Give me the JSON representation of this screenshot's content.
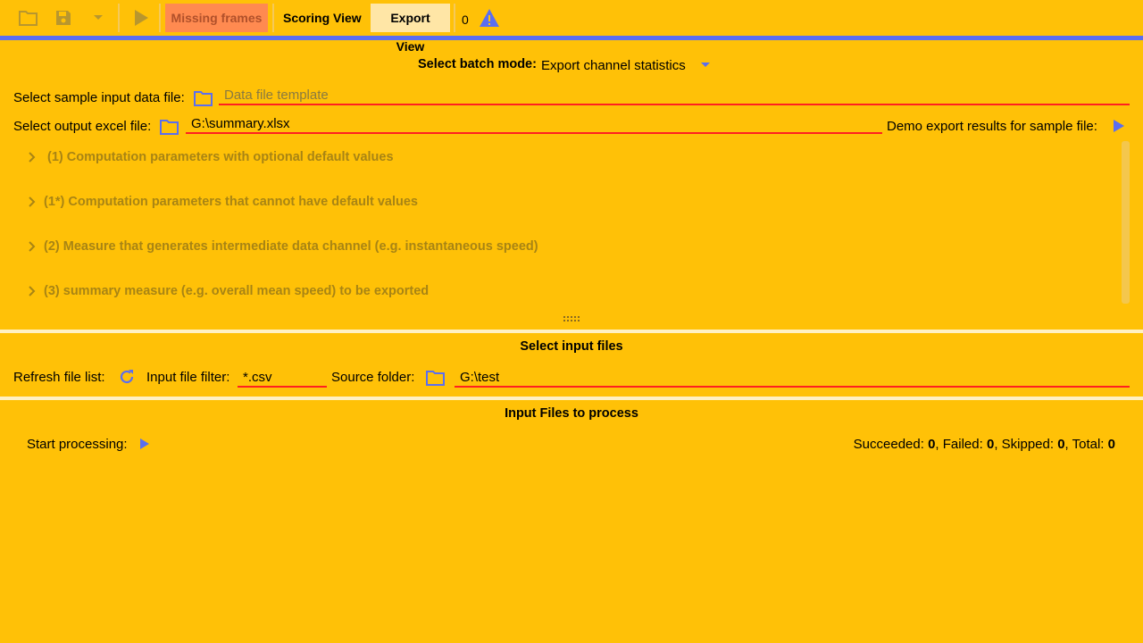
{
  "toolbar": {
    "icons": [
      "folder-open-icon",
      "save-icon",
      "dropdown-icon",
      "play-icon",
      "warning-icon"
    ],
    "missing_frames_label": "Missing frames",
    "scoring_view_label": "Scoring View",
    "export_view_label": "Export View",
    "warning_count": "0"
  },
  "batch_mode": {
    "label": "Select batch mode:",
    "selected": "Export channel statistics"
  },
  "sample_input": {
    "label": "Select sample input data file:",
    "placeholder": "Data file template",
    "value": ""
  },
  "output_excel": {
    "label": "Select output excel file:",
    "value": "G:\\summary.xlsx",
    "demo_label": "Demo export results for sample file:"
  },
  "sections": [
    {
      "label": "(1) Computation parameters with optional default values"
    },
    {
      "label": "(1*) Computation parameters that cannot have default values"
    },
    {
      "label": "(2) Measure that generates intermediate data channel (e.g. instantaneous speed)"
    },
    {
      "label": "(3) summary measure (e.g. overall mean speed) to be exported"
    }
  ],
  "input_files": {
    "title": "Select input files",
    "refresh_label": "Refresh file list:",
    "filter_label": "Input file filter:",
    "filter_value": "*.csv",
    "source_label": "Source folder:",
    "source_value": "G:\\test"
  },
  "process": {
    "title": "Input Files to process",
    "start_label": "Start processing:",
    "succeeded_label": "Succeeded:",
    "succeeded": "0",
    "failed_label": "Failed:",
    "failed": "0",
    "skipped_label": "Skipped:",
    "skipped": "0",
    "total_label": "Total:",
    "total": "0"
  },
  "colors": {
    "background": "#FFC107",
    "accent": "#5B6EF0",
    "underline": "#FF2020",
    "missing_frames_bg": "#FF8A50"
  }
}
